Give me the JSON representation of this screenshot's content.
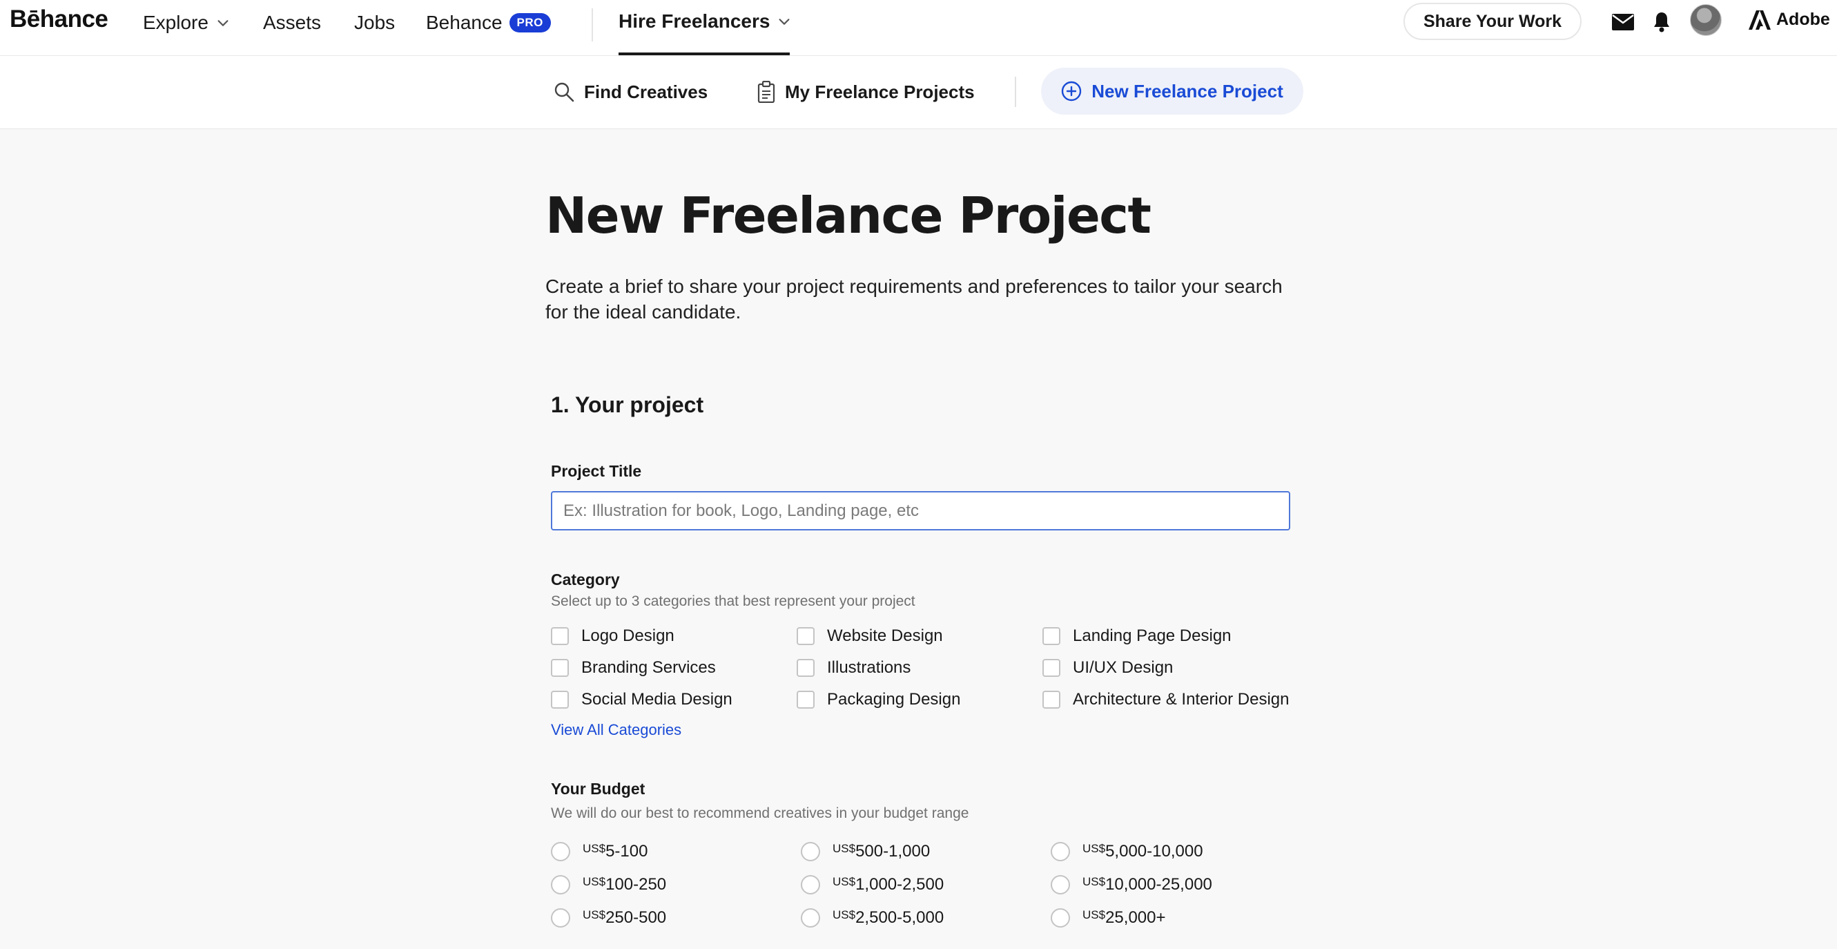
{
  "topnav": {
    "brand": "Bēhance",
    "explore": "Explore",
    "assets": "Assets",
    "jobs": "Jobs",
    "behance_pro": "Behance",
    "pro_badge": "PRO",
    "hire_freelancers": "Hire Freelancers",
    "share_button": "Share Your Work",
    "adobe": "Adobe"
  },
  "subnav": {
    "find_creatives": "Find Creatives",
    "my_projects": "My Freelance Projects",
    "new_project": "New Freelance Project"
  },
  "page": {
    "title": "New Freelance Project",
    "description": "Create a brief to share your project requirements and preferences to tailor your search for the ideal candidate."
  },
  "section1": {
    "title": "1. Your project",
    "project_title_label": "Project Title",
    "project_title_placeholder": "Ex: Illustration for book, Logo, Landing page, etc",
    "project_title_value": "",
    "category_label": "Category",
    "category_hint": "Select up to 3 categories that best represent your project",
    "categories": [
      "Logo Design",
      "Website Design",
      "Landing Page Design",
      "Branding Services",
      "Illustrations",
      "UI/UX Design",
      "Social Media Design",
      "Packaging Design",
      "Architecture & Interior Design"
    ],
    "view_all": "View All Categories",
    "budget_label": "Your Budget",
    "budget_hint": "We will do our best to recommend creatives in your budget range",
    "currency": "US$",
    "budgets": [
      "5-100",
      "500-1,000",
      "5,000-10,000",
      "100-250",
      "1,000-2,500",
      "10,000-25,000",
      "250-500",
      "2,500-5,000",
      "25,000+"
    ]
  },
  "colors": {
    "accent_blue": "#1a4bd6",
    "pro_badge": "#1a3dd6",
    "input_border_focus": "#4f78d9",
    "page_bg": "#f8f8f8"
  }
}
